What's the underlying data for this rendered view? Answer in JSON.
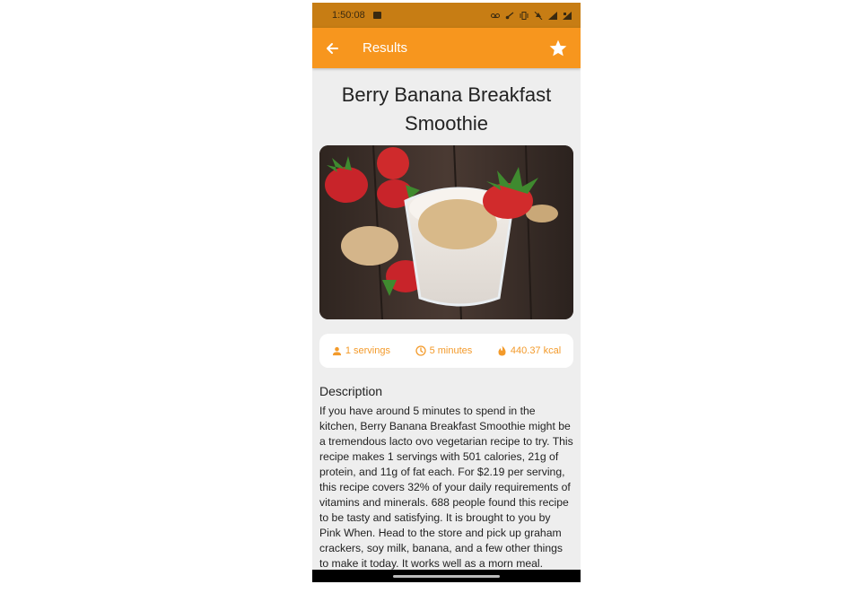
{
  "status_bar": {
    "time": "1:50:08"
  },
  "app_bar": {
    "title": "Results"
  },
  "recipe": {
    "title": "Berry Banana Breakfast Smoothie",
    "servings": "1 servings",
    "time": "5 minutes",
    "calories": "440.37 kcal"
  },
  "description": {
    "heading": "Description",
    "text": "If you have around 5 minutes to spend in the kitchen, Berry Banana Breakfast Smoothie might be a tremendous lacto ovo vegetarian recipe to try. This recipe makes 1 servings with 501 calories, 21g of protein, and 11g of fat each. For $2.19 per serving, this recipe covers 32% of your daily requirements of vitamins and minerals. 688 people found this recipe to be tasty and satisfying. It is brought to you by Pink When. Head to the store and pick up graham crackers, soy milk, banana, and a few other things to make it today. It works well as a morn meal. Overall,"
  },
  "colors": {
    "accent": "#f7961e",
    "status_bar": "#c77d14",
    "info_text": "#f39a2a"
  }
}
